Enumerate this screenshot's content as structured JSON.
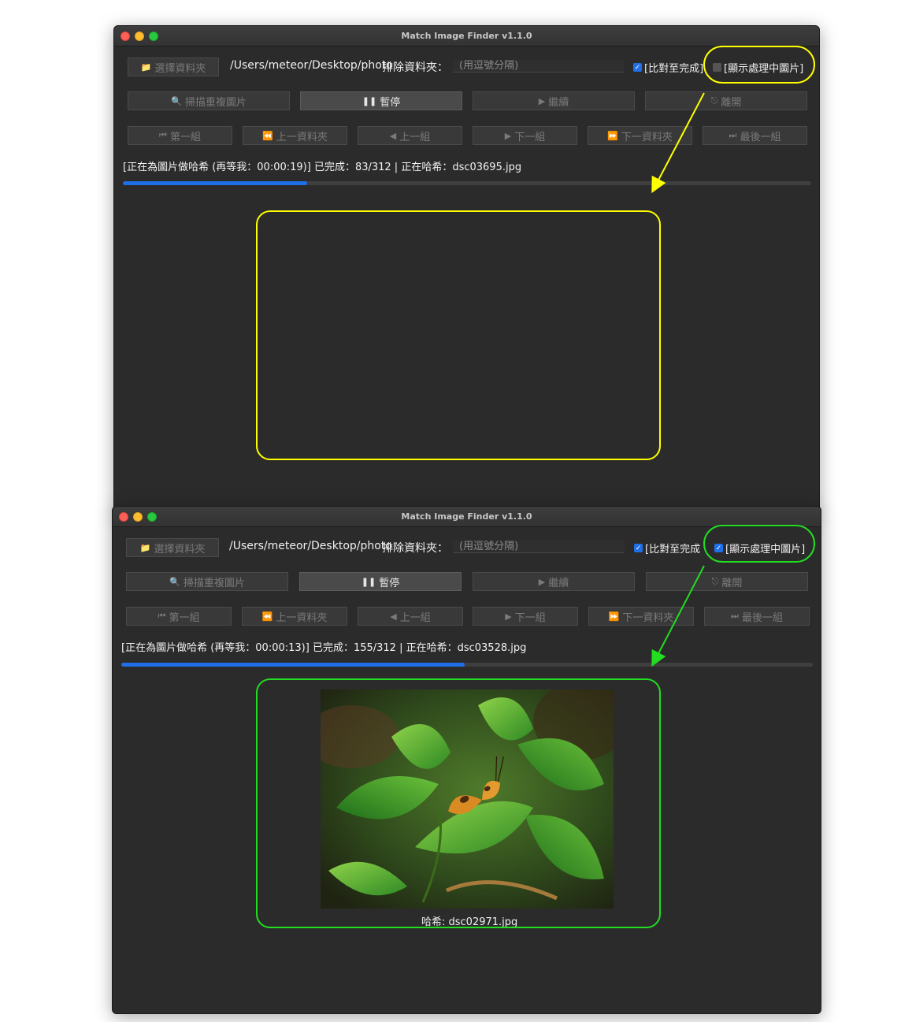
{
  "windows": [
    {
      "title": "Match Image Finder v1.1.0",
      "choose_folder": "選擇資料夾",
      "path": "/Users/meteor/Desktop/photo",
      "exclude_label": "排除資料夾：",
      "exclude_placeholder": "(用逗號分隔)",
      "compare_complete": {
        "label": "[比對至完成]",
        "checked": true
      },
      "show_processing": {
        "label": "[顯示處理中圖片]",
        "checked": false
      },
      "buttons": {
        "scan": "掃描重複圖片",
        "pause": "暫停",
        "continue": "繼續",
        "leave": "離開"
      },
      "nav": {
        "first": "第一組",
        "prev_folder": "上一資料夾",
        "prev": "上一組",
        "next": "下一組",
        "next_folder": "下一資料夾",
        "last": "最後一組"
      },
      "status": "[正在為圖片做哈希 (再等我：00:00:19)] 已完成：83/312 | 正在哈希：dsc03695.jpg",
      "progress": 0.268,
      "caption": ""
    },
    {
      "title": "Match Image Finder v1.1.0",
      "choose_folder": "選擇資料夾",
      "path": "/Users/meteor/Desktop/photo",
      "exclude_label": "排除資料夾：",
      "exclude_placeholder": "(用逗號分隔)",
      "compare_complete": {
        "label": "[比對至完成",
        "checked": true
      },
      "show_processing": {
        "label": "[顯示處理中圖片]",
        "checked": true
      },
      "buttons": {
        "scan": "掃描重複圖片",
        "pause": "暫停",
        "continue": "繼續",
        "leave": "離開"
      },
      "nav": {
        "first": "第一組",
        "prev_folder": "上一資料夾",
        "prev": "上一組",
        "next": "下一組",
        "next_folder": "下一資料夾",
        "last": "最後一組"
      },
      "status": "[正在為圖片做哈希 (再等我：00:00:13)] 已完成：155/312 | 正在哈希：dsc03528.jpg",
      "progress": 0.497,
      "caption": "哈希: dsc02971.jpg"
    }
  ],
  "annotation_colors": {
    "top": "#ffff00",
    "bottom": "#22dd22"
  },
  "accent_color": "#1f6fe8",
  "icons": {
    "folder": "folder-icon",
    "scan": "magnifier-icon",
    "pause": "pause-icon",
    "continue": "play-icon",
    "leave": "exit-icon"
  }
}
